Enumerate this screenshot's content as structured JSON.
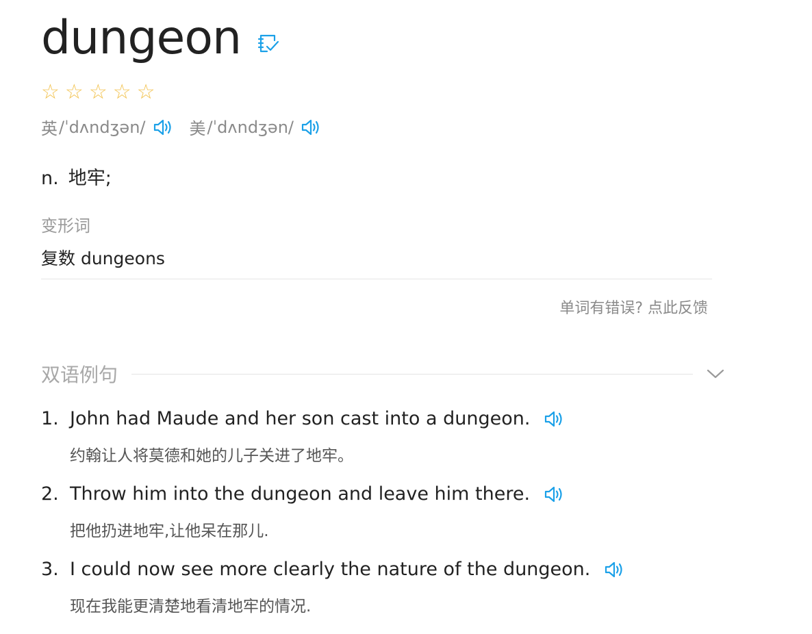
{
  "entry": {
    "headword": "dungeon",
    "stars": [
      "☆",
      "☆",
      "☆",
      "☆",
      "☆"
    ],
    "phonetics": [
      {
        "label": "英",
        "ipa": "/ˈdʌndʒən/"
      },
      {
        "label": "美",
        "ipa": "/ˈdʌndʒən/"
      }
    ],
    "definition": {
      "pos": "n.",
      "meaning": "地牢;"
    },
    "forms": {
      "title": "变形词",
      "label": "复数",
      "value": "dungeons"
    },
    "feedback": "单词有错误? 点此反馈"
  },
  "examples_section": {
    "title": "双语例句",
    "items": [
      {
        "num": "1.",
        "en": "John had Maude and her son cast into a dungeon.",
        "zh": "约翰让人将莫德和她的儿子关进了地牢。"
      },
      {
        "num": "2.",
        "en": "Throw him into the dungeon and leave him there.",
        "zh": "把他扔进地牢,让他呆在那儿."
      },
      {
        "num": "3.",
        "en": "I could now see more clearly the nature of the dungeon.",
        "zh": "现在我能更清楚地看清地牢的情况."
      }
    ]
  },
  "icons": {
    "wordbook": "notebook-check-icon",
    "speaker": "speaker-icon",
    "chevron": "chevron-down-icon",
    "star": "star-outline-icon"
  },
  "colors": {
    "accent": "#1aa0e8",
    "star": "#f2c24e",
    "muted": "#8a8a8a"
  }
}
